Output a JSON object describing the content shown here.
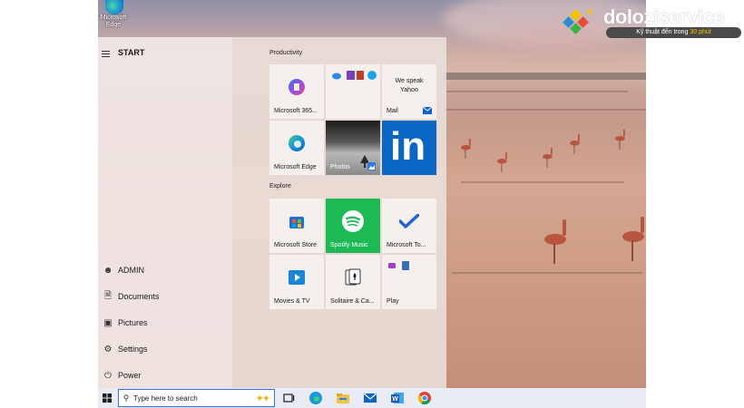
{
  "desktop": {
    "icon_label": "Microsoft Edge"
  },
  "start_menu": {
    "title": "START",
    "side_items": [
      {
        "label": "ADMIN",
        "icon": "user-icon"
      },
      {
        "label": "Documents",
        "icon": "document-icon"
      },
      {
        "label": "Pictures",
        "icon": "picture-icon"
      },
      {
        "label": "Settings",
        "icon": "gear-icon"
      },
      {
        "label": "Power",
        "icon": "power-icon"
      }
    ],
    "groups": [
      {
        "label": "Productivity",
        "tiles": [
          {
            "label": "Microsoft 365...",
            "icon": "microsoft-365-icon"
          },
          {
            "label": "",
            "icon": "office-apps-icon"
          },
          {
            "label": "Mail",
            "text": "We speak Yahoo",
            "icon": "mail-icon"
          },
          {
            "label": "Microsoft Edge",
            "icon": "edge-icon"
          },
          {
            "label": "Photos",
            "icon": "photos-icon"
          },
          {
            "label": "",
            "icon": "linkedin-icon",
            "text": "in"
          }
        ]
      },
      {
        "label": "Explore",
        "tiles": [
          {
            "label": "Microsoft Store",
            "icon": "store-icon"
          },
          {
            "label": "Spotify Music",
            "icon": "spotify-icon"
          },
          {
            "label": "Microsoft To...",
            "icon": "todo-check-icon"
          },
          {
            "label": "Movies & TV",
            "icon": "movies-icon"
          },
          {
            "label": "Solitaire & Ca...",
            "icon": "solitaire-icon"
          },
          {
            "label": "Play",
            "icon": "games-icon"
          }
        ]
      }
    ]
  },
  "taskbar": {
    "search_placeholder": "Type here to search",
    "icons": [
      "windows-logo-icon",
      "task-view-icon",
      "edge-icon",
      "file-explorer-icon",
      "mail-icon",
      "word-icon",
      "chrome-icon"
    ]
  },
  "watermark": {
    "brand": "doloziservice",
    "tagline_prefix": "Kỹ thuật đến trong",
    "tagline_highlight": "30 phút"
  }
}
